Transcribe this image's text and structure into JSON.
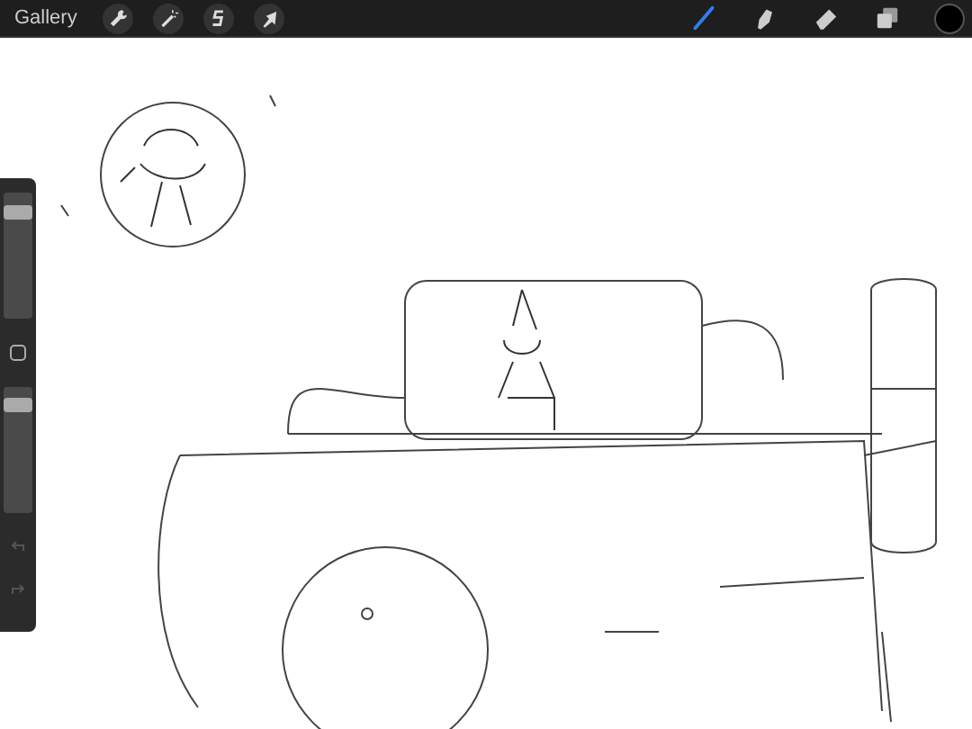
{
  "toolbar": {
    "gallery_label": "Gallery",
    "actions": [
      {
        "kind": "wrench"
      },
      {
        "kind": "wand"
      },
      {
        "kind": "select"
      },
      {
        "kind": "transform"
      }
    ],
    "tools": [
      {
        "kind": "brush",
        "selected": true
      },
      {
        "kind": "smudge",
        "selected": false
      },
      {
        "kind": "eraser",
        "selected": false
      },
      {
        "kind": "layers",
        "selected": false
      }
    ]
  },
  "sidebar": {
    "sliders": [
      {
        "level": 0.88
      },
      {
        "level": 0.9
      }
    ]
  }
}
